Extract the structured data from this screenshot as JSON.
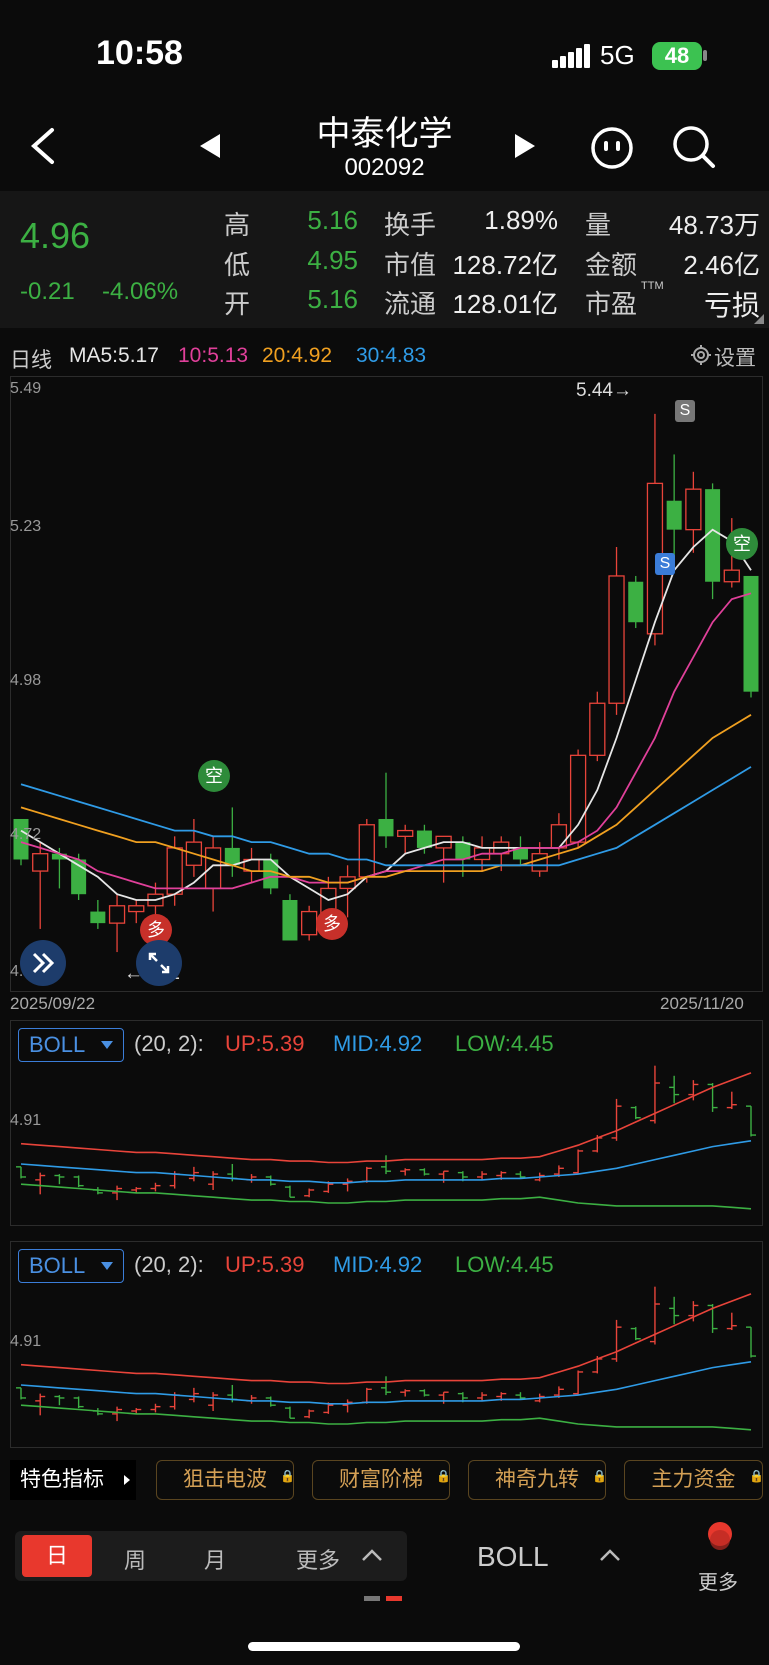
{
  "status": {
    "time": "10:58",
    "network": "5G",
    "battery": "48"
  },
  "header": {
    "title": "中泰化学",
    "code": "002092"
  },
  "quote": {
    "price": "4.96",
    "change": "-0.21",
    "change_pct": "-4.06%",
    "grid": [
      {
        "label": "高",
        "value": "5.16"
      },
      {
        "label": "低",
        "value": "4.95"
      },
      {
        "label": "开",
        "value": "5.16"
      },
      {
        "label": "换手",
        "value": "1.89%"
      },
      {
        "label": "市值",
        "value": "128.72亿"
      },
      {
        "label": "流通",
        "value": "128.01亿"
      },
      {
        "label": "量",
        "value": "48.73万"
      },
      {
        "label": "金额",
        "value": "2.46亿"
      },
      {
        "label": "市盈",
        "sup": "TTM",
        "value": "亏损"
      }
    ]
  },
  "chart_toolbar": {
    "period": "日线",
    "ma5": "MA5:5.17",
    "ma10": "10:5.13",
    "ma20": "20:4.92",
    "ma30": "30:4.83",
    "settings": "设置"
  },
  "main_chart": {
    "y_labels": [
      "5.49",
      "5.23",
      "4.98",
      "4.72",
      "4.46"
    ],
    "high_marker": "5.44→",
    "low_marker": "←4.51",
    "start_date": "2025/09/22",
    "end_date": "2025/11/20",
    "signal_kong": "空",
    "signal_duo": "多",
    "signal_s": "S"
  },
  "boll_panels": [
    {
      "selector": "BOLL",
      "params": "(20, 2):",
      "up": "UP:5.39",
      "mid": "MID:4.92",
      "low": "LOW:4.45",
      "level": "4.91"
    },
    {
      "selector": "BOLL",
      "params": "(20, 2):",
      "up": "UP:5.39",
      "mid": "MID:4.92",
      "low": "LOW:4.45",
      "level": "4.91"
    }
  ],
  "features": {
    "title": "特色指标",
    "buttons": [
      "狙击电波",
      "财富阶梯",
      "神奇九转",
      "主力资金"
    ]
  },
  "bottom_bar": {
    "periods": [
      "日",
      "周",
      "月",
      "更多"
    ],
    "indicator": "BOLL",
    "more": "更多"
  },
  "colors": {
    "up": "#e8443a",
    "down": "#3cb043",
    "ma5": "#e6e6e6",
    "ma10": "#e0409a",
    "ma20": "#f0a020",
    "ma30": "#2f9be6"
  },
  "chart_data": {
    "type": "candlestick",
    "x_range": [
      "2025/09/22",
      "2025/11/20"
    ],
    "ylim": [
      4.46,
      5.49
    ],
    "candles": [
      {
        "o": 4.74,
        "c": 4.67,
        "h": 4.74,
        "l": 4.66
      },
      {
        "o": 4.65,
        "c": 4.68,
        "h": 4.7,
        "l": 4.55
      },
      {
        "o": 4.68,
        "c": 4.67,
        "h": 4.69,
        "l": 4.62
      },
      {
        "o": 4.67,
        "c": 4.61,
        "h": 4.68,
        "l": 4.6
      },
      {
        "o": 4.58,
        "c": 4.56,
        "h": 4.6,
        "l": 4.55
      },
      {
        "o": 4.56,
        "c": 4.59,
        "h": 4.61,
        "l": 4.51
      },
      {
        "o": 4.58,
        "c": 4.59,
        "h": 4.6,
        "l": 4.56
      },
      {
        "o": 4.59,
        "c": 4.61,
        "h": 4.63,
        "l": 4.57
      },
      {
        "o": 4.61,
        "c": 4.69,
        "h": 4.71,
        "l": 4.59
      },
      {
        "o": 4.66,
        "c": 4.7,
        "h": 4.74,
        "l": 4.64
      },
      {
        "o": 4.62,
        "c": 4.69,
        "h": 4.71,
        "l": 4.58
      },
      {
        "o": 4.69,
        "c": 4.66,
        "h": 4.76,
        "l": 4.64
      },
      {
        "o": 4.65,
        "c": 4.67,
        "h": 4.69,
        "l": 4.63
      },
      {
        "o": 4.67,
        "c": 4.62,
        "h": 4.68,
        "l": 4.61
      },
      {
        "o": 4.6,
        "c": 4.53,
        "h": 4.61,
        "l": 4.53
      },
      {
        "o": 4.54,
        "c": 4.58,
        "h": 4.59,
        "l": 4.53
      },
      {
        "o": 4.57,
        "c": 4.62,
        "h": 4.64,
        "l": 4.56
      },
      {
        "o": 4.62,
        "c": 4.64,
        "h": 4.66,
        "l": 4.57
      },
      {
        "o": 4.64,
        "c": 4.73,
        "h": 4.74,
        "l": 4.63
      },
      {
        "o": 4.74,
        "c": 4.71,
        "h": 4.82,
        "l": 4.69
      },
      {
        "o": 4.71,
        "c": 4.72,
        "h": 4.73,
        "l": 4.68
      },
      {
        "o": 4.72,
        "c": 4.69,
        "h": 4.73,
        "l": 4.68
      },
      {
        "o": 4.69,
        "c": 4.71,
        "h": 4.71,
        "l": 4.63
      },
      {
        "o": 4.7,
        "c": 4.67,
        "h": 4.71,
        "l": 4.64
      },
      {
        "o": 4.67,
        "c": 4.69,
        "h": 4.71,
        "l": 4.65
      },
      {
        "o": 4.68,
        "c": 4.7,
        "h": 4.71,
        "l": 4.65
      },
      {
        "o": 4.69,
        "c": 4.67,
        "h": 4.71,
        "l": 4.66
      },
      {
        "o": 4.65,
        "c": 4.68,
        "h": 4.7,
        "l": 4.64
      },
      {
        "o": 4.69,
        "c": 4.73,
        "h": 4.75,
        "l": 4.67
      },
      {
        "o": 4.7,
        "c": 4.85,
        "h": 4.86,
        "l": 4.69
      },
      {
        "o": 4.85,
        "c": 4.94,
        "h": 4.96,
        "l": 4.84
      },
      {
        "o": 4.94,
        "c": 5.16,
        "h": 5.21,
        "l": 4.92
      },
      {
        "o": 5.15,
        "c": 5.08,
        "h": 5.16,
        "l": 5.07
      },
      {
        "o": 5.06,
        "c": 5.32,
        "h": 5.44,
        "l": 5.04
      },
      {
        "o": 5.29,
        "c": 5.24,
        "h": 5.37,
        "l": 5.18
      },
      {
        "o": 5.24,
        "c": 5.31,
        "h": 5.34,
        "l": 5.2
      },
      {
        "o": 5.31,
        "c": 5.15,
        "h": 5.32,
        "l": 5.12
      },
      {
        "o": 5.15,
        "c": 5.17,
        "h": 5.26,
        "l": 5.14
      },
      {
        "o": 5.16,
        "c": 4.96,
        "h": 5.16,
        "l": 4.95
      }
    ],
    "ma": [
      {
        "name": "MA5",
        "values": [
          4.72,
          4.7,
          4.68,
          4.66,
          4.64,
          4.61,
          4.6,
          4.6,
          4.61,
          4.63,
          4.66,
          4.66,
          4.67,
          4.67,
          4.64,
          4.62,
          4.6,
          4.61,
          4.64,
          4.65,
          4.68,
          4.69,
          4.7,
          4.7,
          4.69,
          4.69,
          4.69,
          4.69,
          4.69,
          4.73,
          4.79,
          4.88,
          4.98,
          5.08,
          5.17,
          5.21,
          5.24,
          5.22,
          5.17
        ]
      },
      {
        "name": "MA10",
        "values": [
          4.7,
          4.69,
          4.68,
          4.67,
          4.65,
          4.64,
          4.63,
          4.62,
          4.62,
          4.62,
          4.62,
          4.62,
          4.63,
          4.64,
          4.64,
          4.63,
          4.63,
          4.63,
          4.64,
          4.65,
          4.65,
          4.66,
          4.67,
          4.67,
          4.68,
          4.68,
          4.69,
          4.69,
          4.69,
          4.7,
          4.72,
          4.76,
          4.82,
          4.88,
          4.96,
          5.02,
          5.08,
          5.12,
          5.13
        ]
      },
      {
        "name": "MA20",
        "values": [
          4.76,
          4.75,
          4.74,
          4.73,
          4.72,
          4.71,
          4.7,
          4.7,
          4.69,
          4.68,
          4.67,
          4.66,
          4.65,
          4.65,
          4.64,
          4.64,
          4.63,
          4.63,
          4.64,
          4.64,
          4.65,
          4.65,
          4.65,
          4.65,
          4.65,
          4.66,
          4.66,
          4.67,
          4.68,
          4.69,
          4.71,
          4.73,
          4.76,
          4.79,
          4.82,
          4.85,
          4.88,
          4.9,
          4.92
        ]
      },
      {
        "name": "MA30",
        "values": [
          4.8,
          4.79,
          4.78,
          4.77,
          4.76,
          4.75,
          4.74,
          4.73,
          4.72,
          4.72,
          4.71,
          4.71,
          4.7,
          4.7,
          4.69,
          4.68,
          4.68,
          4.67,
          4.67,
          4.66,
          4.66,
          4.66,
          4.66,
          4.66,
          4.66,
          4.66,
          4.66,
          4.66,
          4.66,
          4.67,
          4.68,
          4.69,
          4.71,
          4.73,
          4.75,
          4.77,
          4.79,
          4.81,
          4.83
        ]
      }
    ]
  }
}
